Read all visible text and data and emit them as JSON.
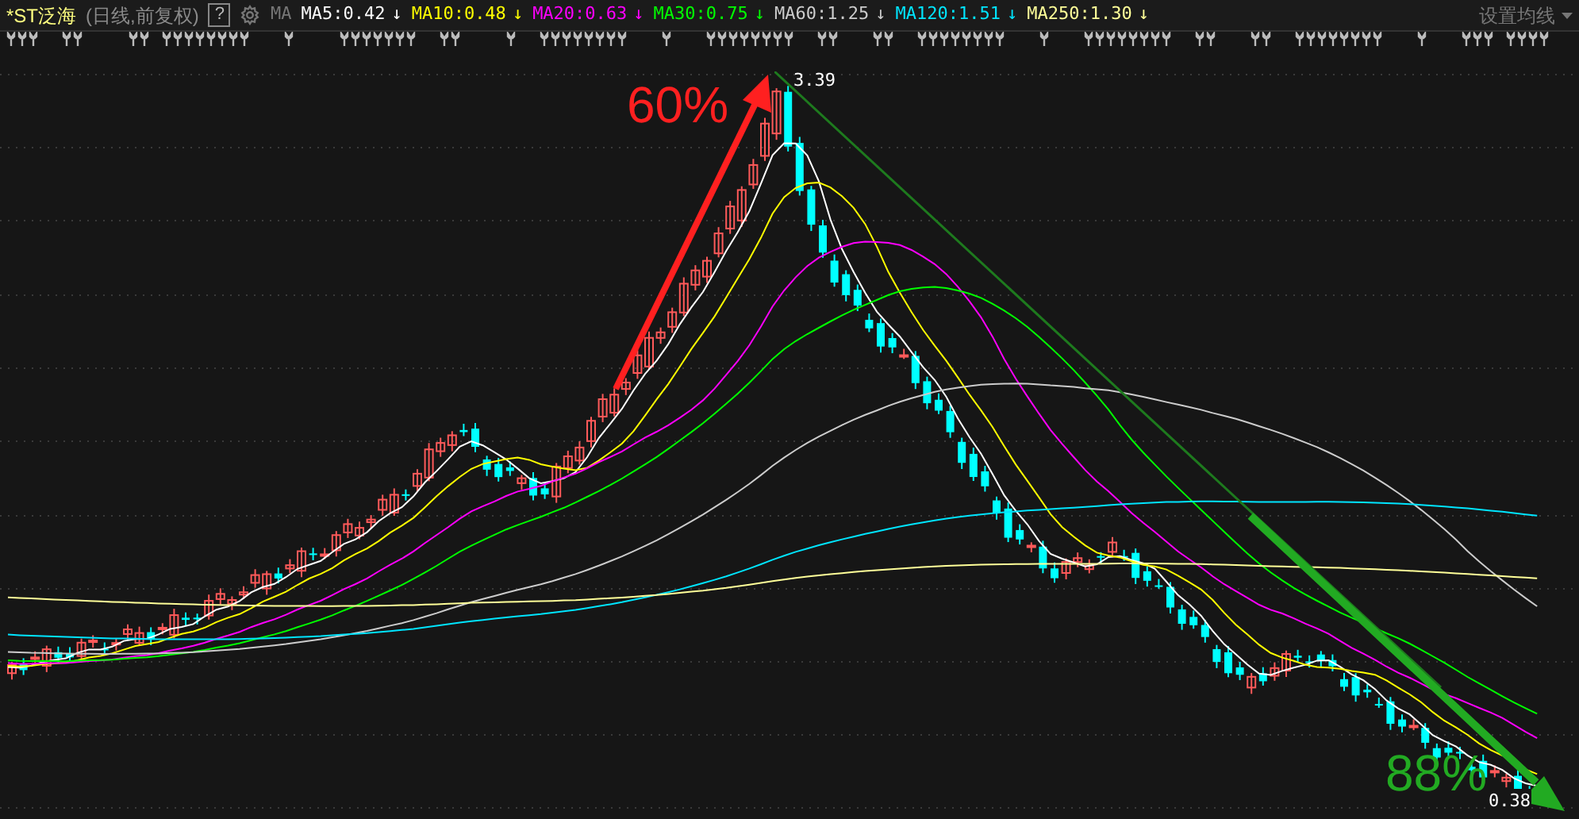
{
  "stock": {
    "name": "*ST泛海",
    "period": "(日线,前复权)"
  },
  "help": "?",
  "ma_label": "MA",
  "ma_lines": [
    {
      "label": "MA5:0.42",
      "arrow": "↓",
      "color": "#ffffff"
    },
    {
      "label": "MA10:0.48",
      "arrow": "↓",
      "color": "#ffff00"
    },
    {
      "label": "MA20:0.63",
      "arrow": "↓",
      "color": "#ff00ff"
    },
    {
      "label": "MA30:0.75",
      "arrow": "↓",
      "color": "#00ff00"
    },
    {
      "label": "MA60:1.25",
      "arrow": "↓",
      "color": "#cccccc"
    },
    {
      "label": "MA120:1.51",
      "arrow": "↓",
      "color": "#00e5ff"
    },
    {
      "label": "MA250:1.30",
      "arrow": "↓",
      "color": "#ffff99"
    }
  ],
  "settings_menu": "设置均线",
  "chart": {
    "peak_label": "3.39",
    "low_label": "0.38",
    "rise_annotation": "60%",
    "fall_annotation": "88%"
  }
}
